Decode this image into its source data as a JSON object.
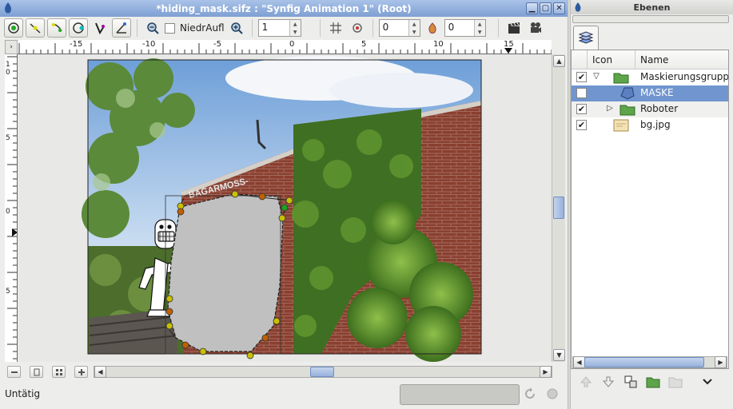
{
  "main_window": {
    "title": "*hiding_mask.sifz : \"Synfig Animation 1\" (Root)",
    "buttons": {
      "minimize": "▁",
      "maximize": "▢",
      "close": "✕"
    }
  },
  "toolbar": {
    "low_res_label": "NiedrAufl",
    "low_res_checked": false,
    "pixel_size_value": "1",
    "frame_start_value": "0",
    "frame_end_value": "0"
  },
  "ruler": {
    "corner_label": "›",
    "h_labels": [
      "-15",
      "-10",
      "-5",
      "0",
      "5",
      "10",
      "15"
    ],
    "v_labels": [
      "1",
      "0",
      "5",
      "0",
      "5"
    ]
  },
  "canvas": {
    "sign_text": "BAGARMOSS-"
  },
  "status": {
    "text": "Untätig"
  },
  "layers_panel": {
    "title": "Ebenen",
    "columns": {
      "icon": "Icon",
      "name": "Name"
    },
    "rows": [
      {
        "name": "Maskierungsgrupp",
        "checked": true,
        "expander": "▽",
        "type": "folder"
      },
      {
        "name": "MASKE",
        "checked": true,
        "expander": "",
        "type": "shape",
        "selected": true
      },
      {
        "name": "Roboter",
        "checked": true,
        "expander": "▷",
        "type": "folder"
      },
      {
        "name": "bg.jpg",
        "checked": true,
        "expander": "",
        "type": "image"
      }
    ]
  },
  "colors": {
    "accent": "#7095cf",
    "title_active": "#7e9fd3",
    "mask_fill": "#c0c0c0",
    "handle_yellow": "#c8c000",
    "handle_orange": "#c06000",
    "handle_green": "#20a020"
  }
}
